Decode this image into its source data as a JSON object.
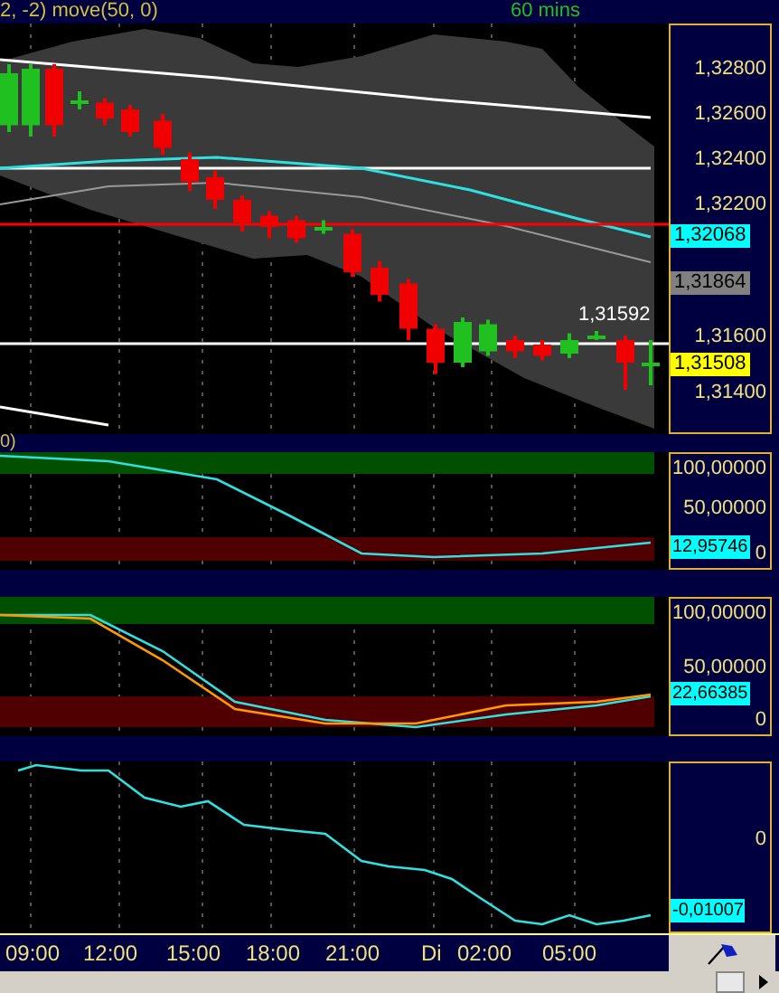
{
  "header": {
    "title": "2, -2) move(50, 0)",
    "timeframe": "60 mins"
  },
  "price_panel": {
    "ticks": [
      "1,32800",
      "1,32600",
      "1,32400",
      "1,32200",
      "1,31600",
      "1,31400"
    ],
    "markers": [
      {
        "text": "1,32068",
        "color": "#00ffff"
      },
      {
        "text": "1,31864",
        "color": "#808080"
      },
      {
        "text": "1,31508",
        "color": "#ffff00"
      }
    ],
    "annotation": "1,31592"
  },
  "gap_label": "0)",
  "indicator_panels": [
    {
      "ticks": [
        "100,00000",
        "50,00000",
        "0"
      ],
      "marker": {
        "text": "12,95746",
        "color": "#00ffff"
      }
    },
    {
      "ticks": [
        "100,00000",
        "50,00000",
        "0"
      ],
      "marker": {
        "text": "22,66385",
        "color": "#00ffff"
      }
    },
    {
      "ticks": [
        "0"
      ],
      "marker": {
        "text": "-0,01007",
        "color": "#00ffff"
      }
    }
  ],
  "time_axis": [
    "09:00",
    "12:00",
    "15:00",
    "18:00",
    "21:00",
    "Di",
    "02:00",
    "05:00"
  ]
}
